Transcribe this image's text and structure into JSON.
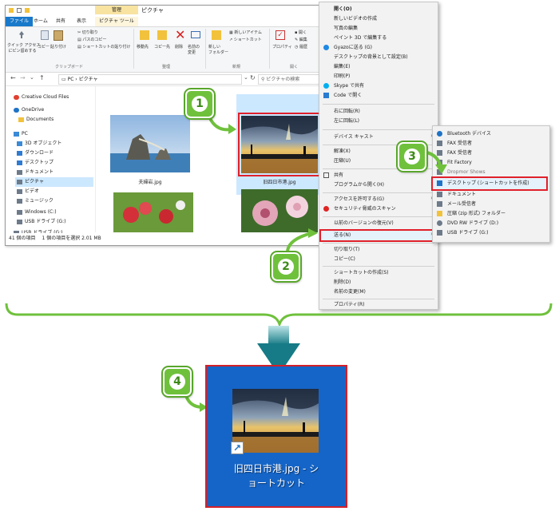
{
  "explorer": {
    "window_title": "ピクチャ",
    "context_tab_header": "管理",
    "tabs": [
      "ファイル",
      "ホーム",
      "共有",
      "表示",
      "ピクチャ ツール"
    ],
    "ribbon": {
      "quick_access": "クイック アクセス\nにピン留めする",
      "copy": "コピー",
      "paste": "貼り付け",
      "cut": "切り取り",
      "copy_path": "パスのコピー",
      "paste_shortcut": "ショートカットの貼り付け",
      "clipboard_group": "クリップボード",
      "move_to": "移動先",
      "copy_to": "コピー先",
      "delete": "削除",
      "rename": "名前の\n変更",
      "organize_group": "整理",
      "new_folder": "新しい\nフォルダー",
      "new_item": "新しいアイテム",
      "shortcut": "ショートカット",
      "new_group": "新規",
      "properties": "プロパティ",
      "open_btn": "開く",
      "edit_btn": "編集",
      "history_btn": "履歴",
      "open_group": "開く"
    },
    "address": {
      "path": "PC  ›  ピクチャ",
      "search_placeholder": "ピクチャの検索"
    },
    "nav": [
      {
        "label": "Creative Cloud Files",
        "icon": "cloud-icon",
        "color": "#e04030"
      },
      {
        "label": "OneDrive",
        "icon": "onedrive-icon",
        "color": "#1f73c6"
      },
      {
        "label": "Documents",
        "icon": "folder-icon",
        "color": "#f2c23c"
      },
      {
        "label": "PC",
        "icon": "pc-icon",
        "color": "#3b8ad6"
      },
      {
        "label": "3D オブジェクト",
        "icon": "cube-icon",
        "color": "#3b8ad6"
      },
      {
        "label": "ダウンロード",
        "icon": "download-icon",
        "color": "#2f7bd1"
      },
      {
        "label": "デスクトップ",
        "icon": "desktop-icon",
        "color": "#2f7bd1"
      },
      {
        "label": "ドキュメント",
        "icon": "document-icon",
        "color": "#6d7a8a"
      },
      {
        "label": "ピクチャ",
        "icon": "pictures-icon",
        "color": "#6d7a8a"
      },
      {
        "label": "ビデオ",
        "icon": "video-icon",
        "color": "#6d7a8a"
      },
      {
        "label": "ミュージック",
        "icon": "music-icon",
        "color": "#6d7a8a"
      },
      {
        "label": "Windows (C:)",
        "icon": "drive-icon",
        "color": "#6d7a8a"
      },
      {
        "label": "USB ドライブ (G:)",
        "icon": "usb-icon",
        "color": "#6d7a8a"
      },
      {
        "label": "USB ドライブ (G:)",
        "icon": "usb-icon",
        "color": "#6d7a8a"
      }
    ],
    "files": [
      {
        "name": "夫婦岩.jpg"
      },
      {
        "name": "旧四日市港.jpg"
      },
      {
        "name": ""
      },
      {
        "name": ""
      }
    ],
    "status": {
      "count": "41 個の項目",
      "selection": "1 個の項目を選択  2.01 MB"
    }
  },
  "context_menu": {
    "items": [
      {
        "label": "開く(O)"
      },
      {
        "label": "新しいビデオの作成"
      },
      {
        "label": "写真の編集"
      },
      {
        "label": "ペイント 3D で編集する"
      },
      {
        "label": "Gyazoに送る (G)"
      },
      {
        "label": "デスクトップの背景として設定(B)"
      },
      {
        "label": "編集(E)"
      },
      {
        "label": "印刷(P)"
      },
      {
        "label": "Skype で共有"
      },
      {
        "label": "Code で開く"
      },
      {
        "label": "右に回転(R)"
      },
      {
        "label": "左に回転(L)"
      },
      {
        "label": "デバイス キャスト"
      },
      {
        "label": "解凍(X)"
      },
      {
        "label": "圧縮(U)"
      },
      {
        "label": "共有"
      },
      {
        "label": "プログラムから開く(H)"
      },
      {
        "label": "アクセスを許可する(G)"
      },
      {
        "label": "セキュリティ脅威のスキャン"
      },
      {
        "label": "以前のバージョンの復元(V)"
      },
      {
        "label": "送る(N)"
      },
      {
        "label": "切り取り(T)"
      },
      {
        "label": "コピー(C)"
      },
      {
        "label": "ショートカットの作成(S)"
      },
      {
        "label": "削除(D)"
      },
      {
        "label": "名前の変更(M)"
      },
      {
        "label": "プロパティ(R)"
      }
    ]
  },
  "send_to_menu": {
    "items": [
      {
        "label": "Bluetooth デバイス",
        "icon": "bluetooth-icon",
        "color": "#1f73c6"
      },
      {
        "label": "FAX 受信者",
        "icon": "fax-icon",
        "color": "#6d7a8a"
      },
      {
        "label": "FAX 受信者",
        "icon": "fax-icon",
        "color": "#6d7a8a"
      },
      {
        "label": "Fit Factory",
        "icon": "app-icon",
        "color": "#6d7a8a"
      },
      {
        "label": "Dropmor Shows",
        "icon": "app-icon",
        "color": "#6d7a8a"
      },
      {
        "label": "デスクトップ (ショートカットを作成)",
        "icon": "desktop-icon",
        "color": "#1f73c6"
      },
      {
        "label": "ドキュメント",
        "icon": "document-icon",
        "color": "#6d7a8a"
      },
      {
        "label": "メール受信者",
        "icon": "mail-icon",
        "color": "#6d7a8a"
      },
      {
        "label": "圧縮 (zip 形式) フォルダー",
        "icon": "zip-folder-icon",
        "color": "#f2c23c"
      },
      {
        "label": "DVD RW ドライブ (D:)",
        "icon": "dvd-icon",
        "color": "#6d7a8a"
      },
      {
        "label": "USB ドライブ (G:)",
        "icon": "usb-icon",
        "color": "#6d7a8a"
      }
    ]
  },
  "annotations": {
    "step1": "1",
    "step2": "2",
    "step3": "3",
    "step4": "4"
  },
  "desktop_shortcut": {
    "label_line1": "旧四日市港.jpg - シ",
    "label_line2": "ョートカット"
  },
  "colors": {
    "badge_green": "#6fc13c",
    "highlight_red": "#e0202a",
    "desktop_blue": "#1565c8",
    "selection_blue": "#cce8ff"
  }
}
